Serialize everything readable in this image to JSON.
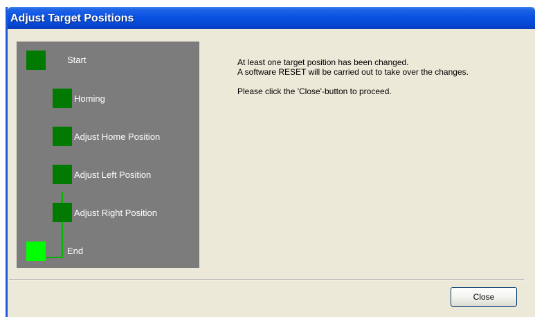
{
  "window": {
    "title": "Adjust Target Positions"
  },
  "steps": [
    {
      "label": "Start",
      "state": "done"
    },
    {
      "label": "Homing",
      "state": "done"
    },
    {
      "label": "Adjust Home Position",
      "state": "done"
    },
    {
      "label": "Adjust Left Position",
      "state": "done"
    },
    {
      "label": "Adjust Right Position",
      "state": "done"
    },
    {
      "label": "End",
      "state": "current"
    }
  ],
  "colors": {
    "panel_background": "#7c7c7c",
    "step_done": "#007a00",
    "step_current": "#00ff00",
    "connector": "#00b400"
  },
  "message": {
    "line1": "At least one target position has been changed.",
    "line2": "A software RESET will be carried out to take over the changes.",
    "line3": "Please click the 'Close'-button to proceed."
  },
  "buttons": {
    "close": "Close"
  }
}
